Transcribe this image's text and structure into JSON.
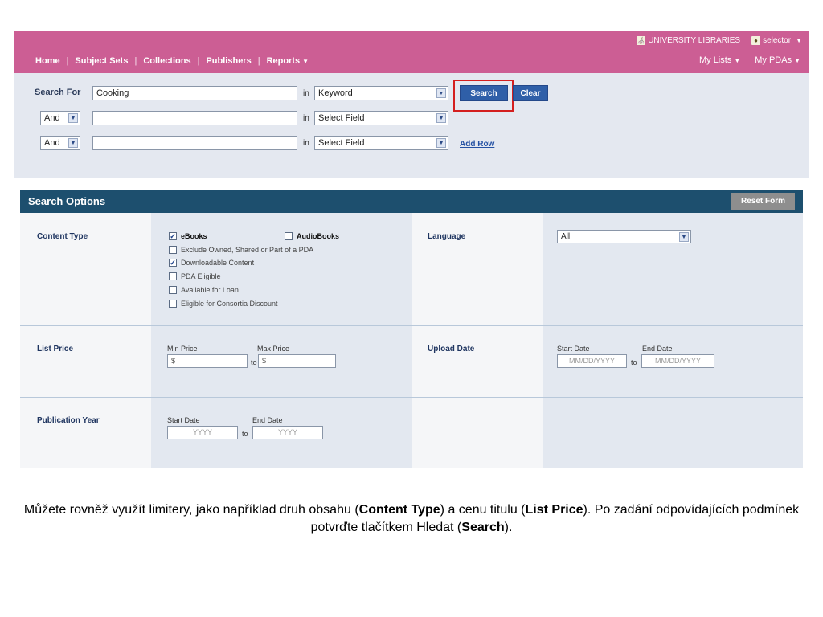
{
  "util": {
    "library": "UNIVERSITY LIBRARIES",
    "user": "selector"
  },
  "nav": {
    "items": [
      "Home",
      "Subject Sets",
      "Collections",
      "Publishers",
      "Reports"
    ],
    "right": [
      "My Lists",
      "My PDAs"
    ]
  },
  "search": {
    "label": "Search For",
    "query": "Cooking",
    "in_word": "in",
    "field1": "Keyword",
    "field2": "Select Field",
    "field3": "Select Field",
    "op2": "And",
    "op3": "And",
    "search_btn": "Search",
    "clear_btn": "Clear",
    "add_row": "Add Row"
  },
  "options": {
    "title": "Search Options",
    "reset": "Reset Form",
    "content_type": "Content Type",
    "ebooks": "eBooks",
    "audiobooks": "AudioBooks",
    "exclude": "Exclude Owned, Shared or Part of a PDA",
    "downloadable": "Downloadable Content",
    "pda": "PDA Eligible",
    "loan": "Available for Loan",
    "consortia": "Eligible for Consortia Discount",
    "language": "Language",
    "language_value": "All",
    "list_price": "List Price",
    "min_price": "Min Price",
    "max_price": "Max Price",
    "dollar": "$",
    "to": "to",
    "upload_date": "Upload Date",
    "start_date": "Start Date",
    "end_date": "End Date",
    "date_ph": "MM/DD/YYYY",
    "pub_year": "Publication Year",
    "year_ph": "YYYY"
  },
  "caption": {
    "p1": "Můžete rovněž využít limitery, jako například druh obsahu (",
    "b1": "Content Type",
    "p2": ") a cenu titulu (",
    "b2": "List Price",
    "p3": "). Po zadání odpovídajících podmínek potvrďte tlačítkem Hledat (",
    "b3": "Search",
    "p4": ")."
  },
  "colors": {
    "topbar": "#cc5e94",
    "options_header": "#1d4f6e",
    "highlight": "#d41f1f"
  }
}
